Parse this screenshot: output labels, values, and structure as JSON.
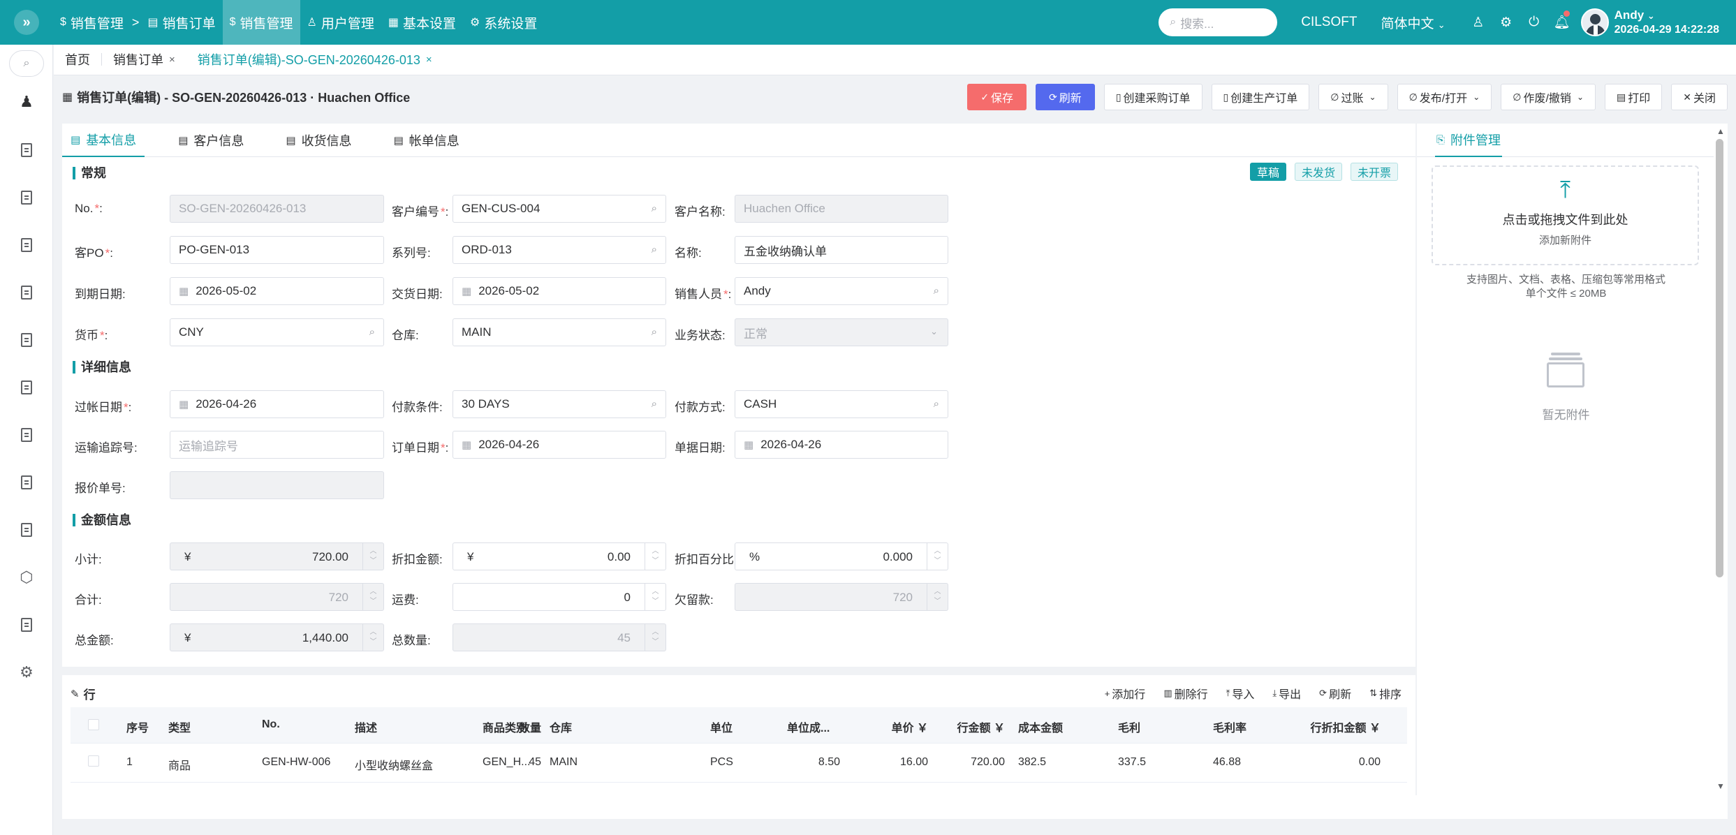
{
  "topbar": {
    "breadcrumb": [
      {
        "icon": "dollar-circle-icon",
        "label": "销售管理"
      },
      {
        "icon": "file-icon",
        "label": "销售订单"
      }
    ],
    "breadcrumb_sep": ">",
    "nav": [
      {
        "icon": "dollar-circle-icon",
        "label": "销售管理",
        "active": true
      },
      {
        "icon": "user-icon",
        "label": "用户管理"
      },
      {
        "icon": "grid-icon",
        "label": "基本设置"
      },
      {
        "icon": "gear-icon",
        "label": "系统设置"
      }
    ],
    "search_placeholder": "搜索...",
    "company": "CILSOFT",
    "language": "简体中文",
    "user_name": "Andy",
    "datetime": "2026-04-29 14:22:28",
    "accent_color": "#139ea7"
  },
  "tabs": [
    {
      "label": "首页"
    },
    {
      "label": "销售订单",
      "close": "×"
    },
    {
      "label": "销售订单(编辑)-SO-GEN-20260426-013",
      "close": "×",
      "active": true
    }
  ],
  "page": {
    "title": "销售订单(编辑) - SO-GEN-20260426-013 · Huachen Office"
  },
  "actions": [
    {
      "label": "保存",
      "icon": "check-icon",
      "style": "danger"
    },
    {
      "label": "刷新",
      "icon": "refresh-icon",
      "style": "primary"
    },
    {
      "label": "创建采购订单",
      "icon": "clipboard-icon"
    },
    {
      "label": "创建生产订单",
      "icon": "clipboard-icon"
    },
    {
      "label": "过账",
      "icon": "link-icon",
      "dropdown": true
    },
    {
      "label": "发布/打开",
      "icon": "link-icon",
      "dropdown": true
    },
    {
      "label": "作废/撤销",
      "icon": "link-icon",
      "dropdown": true
    },
    {
      "label": "打印",
      "icon": "print-icon"
    },
    {
      "label": "关闭",
      "icon": "close-icon"
    }
  ],
  "form_tabs": [
    "基本信息",
    "客户信息",
    "收货信息",
    "帐单信息"
  ],
  "status_tags": [
    {
      "label": "草稿",
      "solid": true
    },
    {
      "label": "未发货"
    },
    {
      "label": "未开票"
    }
  ],
  "sections": {
    "general": "常规",
    "detail": "详细信息",
    "amount": "金额信息"
  },
  "fields": {
    "no": {
      "label": "No.",
      "required": true,
      "value": "SO-GEN-20260426-013"
    },
    "customer_code": {
      "label": "客户编号",
      "required": true,
      "value": "GEN-CUS-004"
    },
    "customer_name": {
      "label": "客户名称:",
      "value": "Huachen Office"
    },
    "customer_po": {
      "label": "客PO",
      "required": true,
      "value": "PO-GEN-013"
    },
    "series_no": {
      "label": "系列号:",
      "value": "ORD-013"
    },
    "name": {
      "label": "名称:",
      "value": "五金收纳确认单"
    },
    "due_date": {
      "label": "到期日期:",
      "value": "2026-05-02"
    },
    "delivery_date": {
      "label": "交货日期:",
      "value": "2026-05-02"
    },
    "salesperson": {
      "label": "销售人员",
      "required": true,
      "value": "Andy"
    },
    "currency": {
      "label": "货币",
      "required": true,
      "value": "CNY"
    },
    "warehouse": {
      "label": "仓库:",
      "value": "MAIN"
    },
    "business_status": {
      "label": "业务状态:",
      "value": "正常"
    },
    "posting_date": {
      "label": "过帐日期",
      "required": true,
      "value": "2026-04-26"
    },
    "payment_terms": {
      "label": "付款条件:",
      "value": "30 DAYS"
    },
    "payment_method": {
      "label": "付款方式:",
      "value": "CASH"
    },
    "tracking_no": {
      "label": "运输追踪号:",
      "placeholder": "运输追踪号"
    },
    "order_date": {
      "label": "订单日期",
      "required": true,
      "value": "2026-04-26"
    },
    "doc_date": {
      "label": "单据日期:",
      "value": "2026-04-26"
    },
    "quote_no": {
      "label": "报价单号:",
      "value": ""
    },
    "subtotal": {
      "label": "小计:",
      "prefix": "¥",
      "value": "720.00"
    },
    "discount_amount": {
      "label": "折扣金额:",
      "prefix": "¥",
      "value": "0.00"
    },
    "discount_percent": {
      "label": "折扣百分比:",
      "prefix": "%",
      "value": "0.000"
    },
    "total": {
      "label": "合计:",
      "value": "720"
    },
    "freight": {
      "label": "运费:",
      "value": "0"
    },
    "arrears": {
      "label": "欠留款:",
      "value": "720"
    },
    "grand_total": {
      "label": "总金额:",
      "prefix": "¥",
      "value": "1,440.00"
    },
    "total_qty": {
      "label": "总数量:",
      "value": "45"
    }
  },
  "attachments": {
    "tab": "附件管理",
    "drop_main": "点击或拖拽文件到此处",
    "drop_sub": "添加新附件",
    "hint1": "支持图片、文档、表格、压缩包等常用格式",
    "hint2": "单个文件 ≤ 20MB",
    "empty": "暂无附件"
  },
  "lines": {
    "title": "行",
    "actions": [
      {
        "label": "添加行",
        "icon": "plus-icon"
      },
      {
        "label": "删除行",
        "icon": "trash-icon"
      },
      {
        "label": "导入",
        "icon": "upload-icon"
      },
      {
        "label": "导出",
        "icon": "download-icon"
      },
      {
        "label": "刷新",
        "icon": "refresh-icon"
      },
      {
        "label": "排序",
        "icon": "sort-icon"
      }
    ],
    "columns": [
      "序号",
      "类型",
      "No.",
      "描述",
      "商品类别",
      "仓库",
      "数量",
      "单位",
      "单位成...",
      "单价 ￥",
      "行金额 ￥",
      "成本金额",
      "毛利",
      "毛利率",
      "行折扣金额 ￥"
    ],
    "rows": [
      [
        "1",
        "商品",
        "GEN-HW-006",
        "小型收纳螺丝盒",
        "GEN_H...",
        "MAIN",
        "45",
        "PCS",
        "8.50",
        "16.00",
        "720.00",
        "382.5",
        "337.5",
        "46.88",
        "0.00"
      ]
    ]
  }
}
